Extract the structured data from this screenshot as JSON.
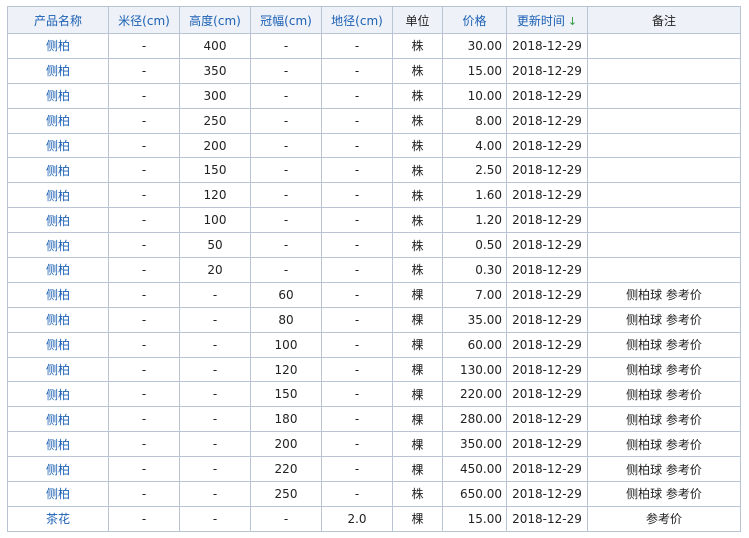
{
  "columns": {
    "name": "产品名称",
    "diameter": "米径(cm)",
    "height": "高度(cm)",
    "crown": "冠幅(cm)",
    "ground": "地径(cm)",
    "unit": "单位",
    "price": "价格",
    "updated": "更新时间",
    "note": "备注"
  },
  "sort_icon": "↓",
  "sort_color": "#2e9a3c",
  "link_color": "#1a5fb4",
  "rows": [
    {
      "name": "侧柏",
      "diameter": "-",
      "height": "400",
      "crown": "-",
      "ground": "-",
      "unit": "株",
      "price": "30.00",
      "updated": "2018-12-29",
      "note": ""
    },
    {
      "name": "侧柏",
      "diameter": "-",
      "height": "350",
      "crown": "-",
      "ground": "-",
      "unit": "株",
      "price": "15.00",
      "updated": "2018-12-29",
      "note": ""
    },
    {
      "name": "侧柏",
      "diameter": "-",
      "height": "300",
      "crown": "-",
      "ground": "-",
      "unit": "株",
      "price": "10.00",
      "updated": "2018-12-29",
      "note": ""
    },
    {
      "name": "侧柏",
      "diameter": "-",
      "height": "250",
      "crown": "-",
      "ground": "-",
      "unit": "株",
      "price": "8.00",
      "updated": "2018-12-29",
      "note": ""
    },
    {
      "name": "侧柏",
      "diameter": "-",
      "height": "200",
      "crown": "-",
      "ground": "-",
      "unit": "株",
      "price": "4.00",
      "updated": "2018-12-29",
      "note": ""
    },
    {
      "name": "侧柏",
      "diameter": "-",
      "height": "150",
      "crown": "-",
      "ground": "-",
      "unit": "株",
      "price": "2.50",
      "updated": "2018-12-29",
      "note": ""
    },
    {
      "name": "侧柏",
      "diameter": "-",
      "height": "120",
      "crown": "-",
      "ground": "-",
      "unit": "株",
      "price": "1.60",
      "updated": "2018-12-29",
      "note": ""
    },
    {
      "name": "侧柏",
      "diameter": "-",
      "height": "100",
      "crown": "-",
      "ground": "-",
      "unit": "株",
      "price": "1.20",
      "updated": "2018-12-29",
      "note": ""
    },
    {
      "name": "侧柏",
      "diameter": "-",
      "height": "50",
      "crown": "-",
      "ground": "-",
      "unit": "株",
      "price": "0.50",
      "updated": "2018-12-29",
      "note": ""
    },
    {
      "name": "侧柏",
      "diameter": "-",
      "height": "20",
      "crown": "-",
      "ground": "-",
      "unit": "株",
      "price": "0.30",
      "updated": "2018-12-29",
      "note": ""
    },
    {
      "name": "侧柏",
      "diameter": "-",
      "height": "-",
      "crown": "60",
      "ground": "-",
      "unit": "棵",
      "price": "7.00",
      "updated": "2018-12-29",
      "note": "侧柏球 参考价"
    },
    {
      "name": "侧柏",
      "diameter": "-",
      "height": "-",
      "crown": "80",
      "ground": "-",
      "unit": "棵",
      "price": "35.00",
      "updated": "2018-12-29",
      "note": "侧柏球 参考价"
    },
    {
      "name": "侧柏",
      "diameter": "-",
      "height": "-",
      "crown": "100",
      "ground": "-",
      "unit": "棵",
      "price": "60.00",
      "updated": "2018-12-29",
      "note": "侧柏球 参考价"
    },
    {
      "name": "侧柏",
      "diameter": "-",
      "height": "-",
      "crown": "120",
      "ground": "-",
      "unit": "棵",
      "price": "130.00",
      "updated": "2018-12-29",
      "note": "侧柏球 参考价"
    },
    {
      "name": "侧柏",
      "diameter": "-",
      "height": "-",
      "crown": "150",
      "ground": "-",
      "unit": "棵",
      "price": "220.00",
      "updated": "2018-12-29",
      "note": "侧柏球 参考价"
    },
    {
      "name": "侧柏",
      "diameter": "-",
      "height": "-",
      "crown": "180",
      "ground": "-",
      "unit": "棵",
      "price": "280.00",
      "updated": "2018-12-29",
      "note": "侧柏球 参考价"
    },
    {
      "name": "侧柏",
      "diameter": "-",
      "height": "-",
      "crown": "200",
      "ground": "-",
      "unit": "棵",
      "price": "350.00",
      "updated": "2018-12-29",
      "note": "侧柏球 参考价"
    },
    {
      "name": "侧柏",
      "diameter": "-",
      "height": "-",
      "crown": "220",
      "ground": "-",
      "unit": "棵",
      "price": "450.00",
      "updated": "2018-12-29",
      "note": "侧柏球 参考价"
    },
    {
      "name": "侧柏",
      "diameter": "-",
      "height": "-",
      "crown": "250",
      "ground": "-",
      "unit": "株",
      "price": "650.00",
      "updated": "2018-12-29",
      "note": "侧柏球 参考价"
    },
    {
      "name": "茶花",
      "diameter": "-",
      "height": "-",
      "crown": "-",
      "ground": "2.0",
      "unit": "棵",
      "price": "15.00",
      "updated": "2018-12-29",
      "note": "参考价"
    }
  ]
}
